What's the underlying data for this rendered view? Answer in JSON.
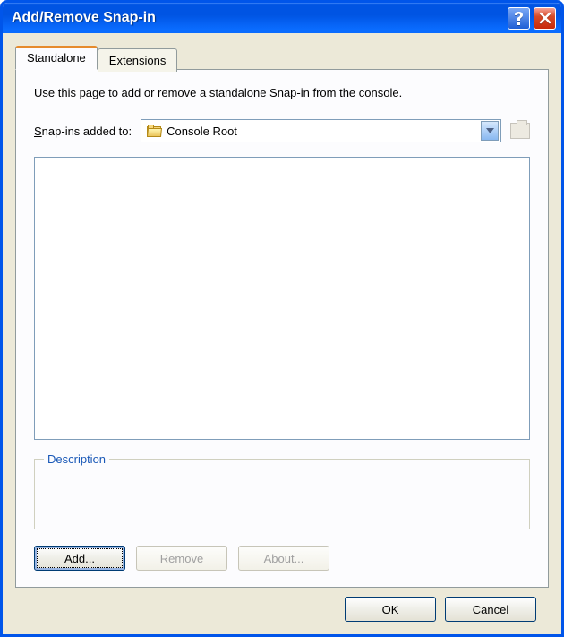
{
  "window": {
    "title": "Add/Remove Snap-in"
  },
  "tabs": {
    "standalone": "Standalone",
    "extensions": "Extensions"
  },
  "panel": {
    "intro": "Use this page to add or remove a standalone Snap-in from the console.",
    "added_to_label_pre": "S",
    "added_to_label_post": "nap-ins added to:",
    "combo_value": "Console Root",
    "description_legend": "Description",
    "buttons": {
      "add_pre": "A",
      "add_mid": "d",
      "add_post": "d...",
      "remove_pre": "R",
      "remove_mid": "e",
      "remove_post": "move",
      "about_pre": "A",
      "about_mid": "b",
      "about_post": "out..."
    }
  },
  "footer": {
    "ok": "OK",
    "cancel": "Cancel"
  }
}
